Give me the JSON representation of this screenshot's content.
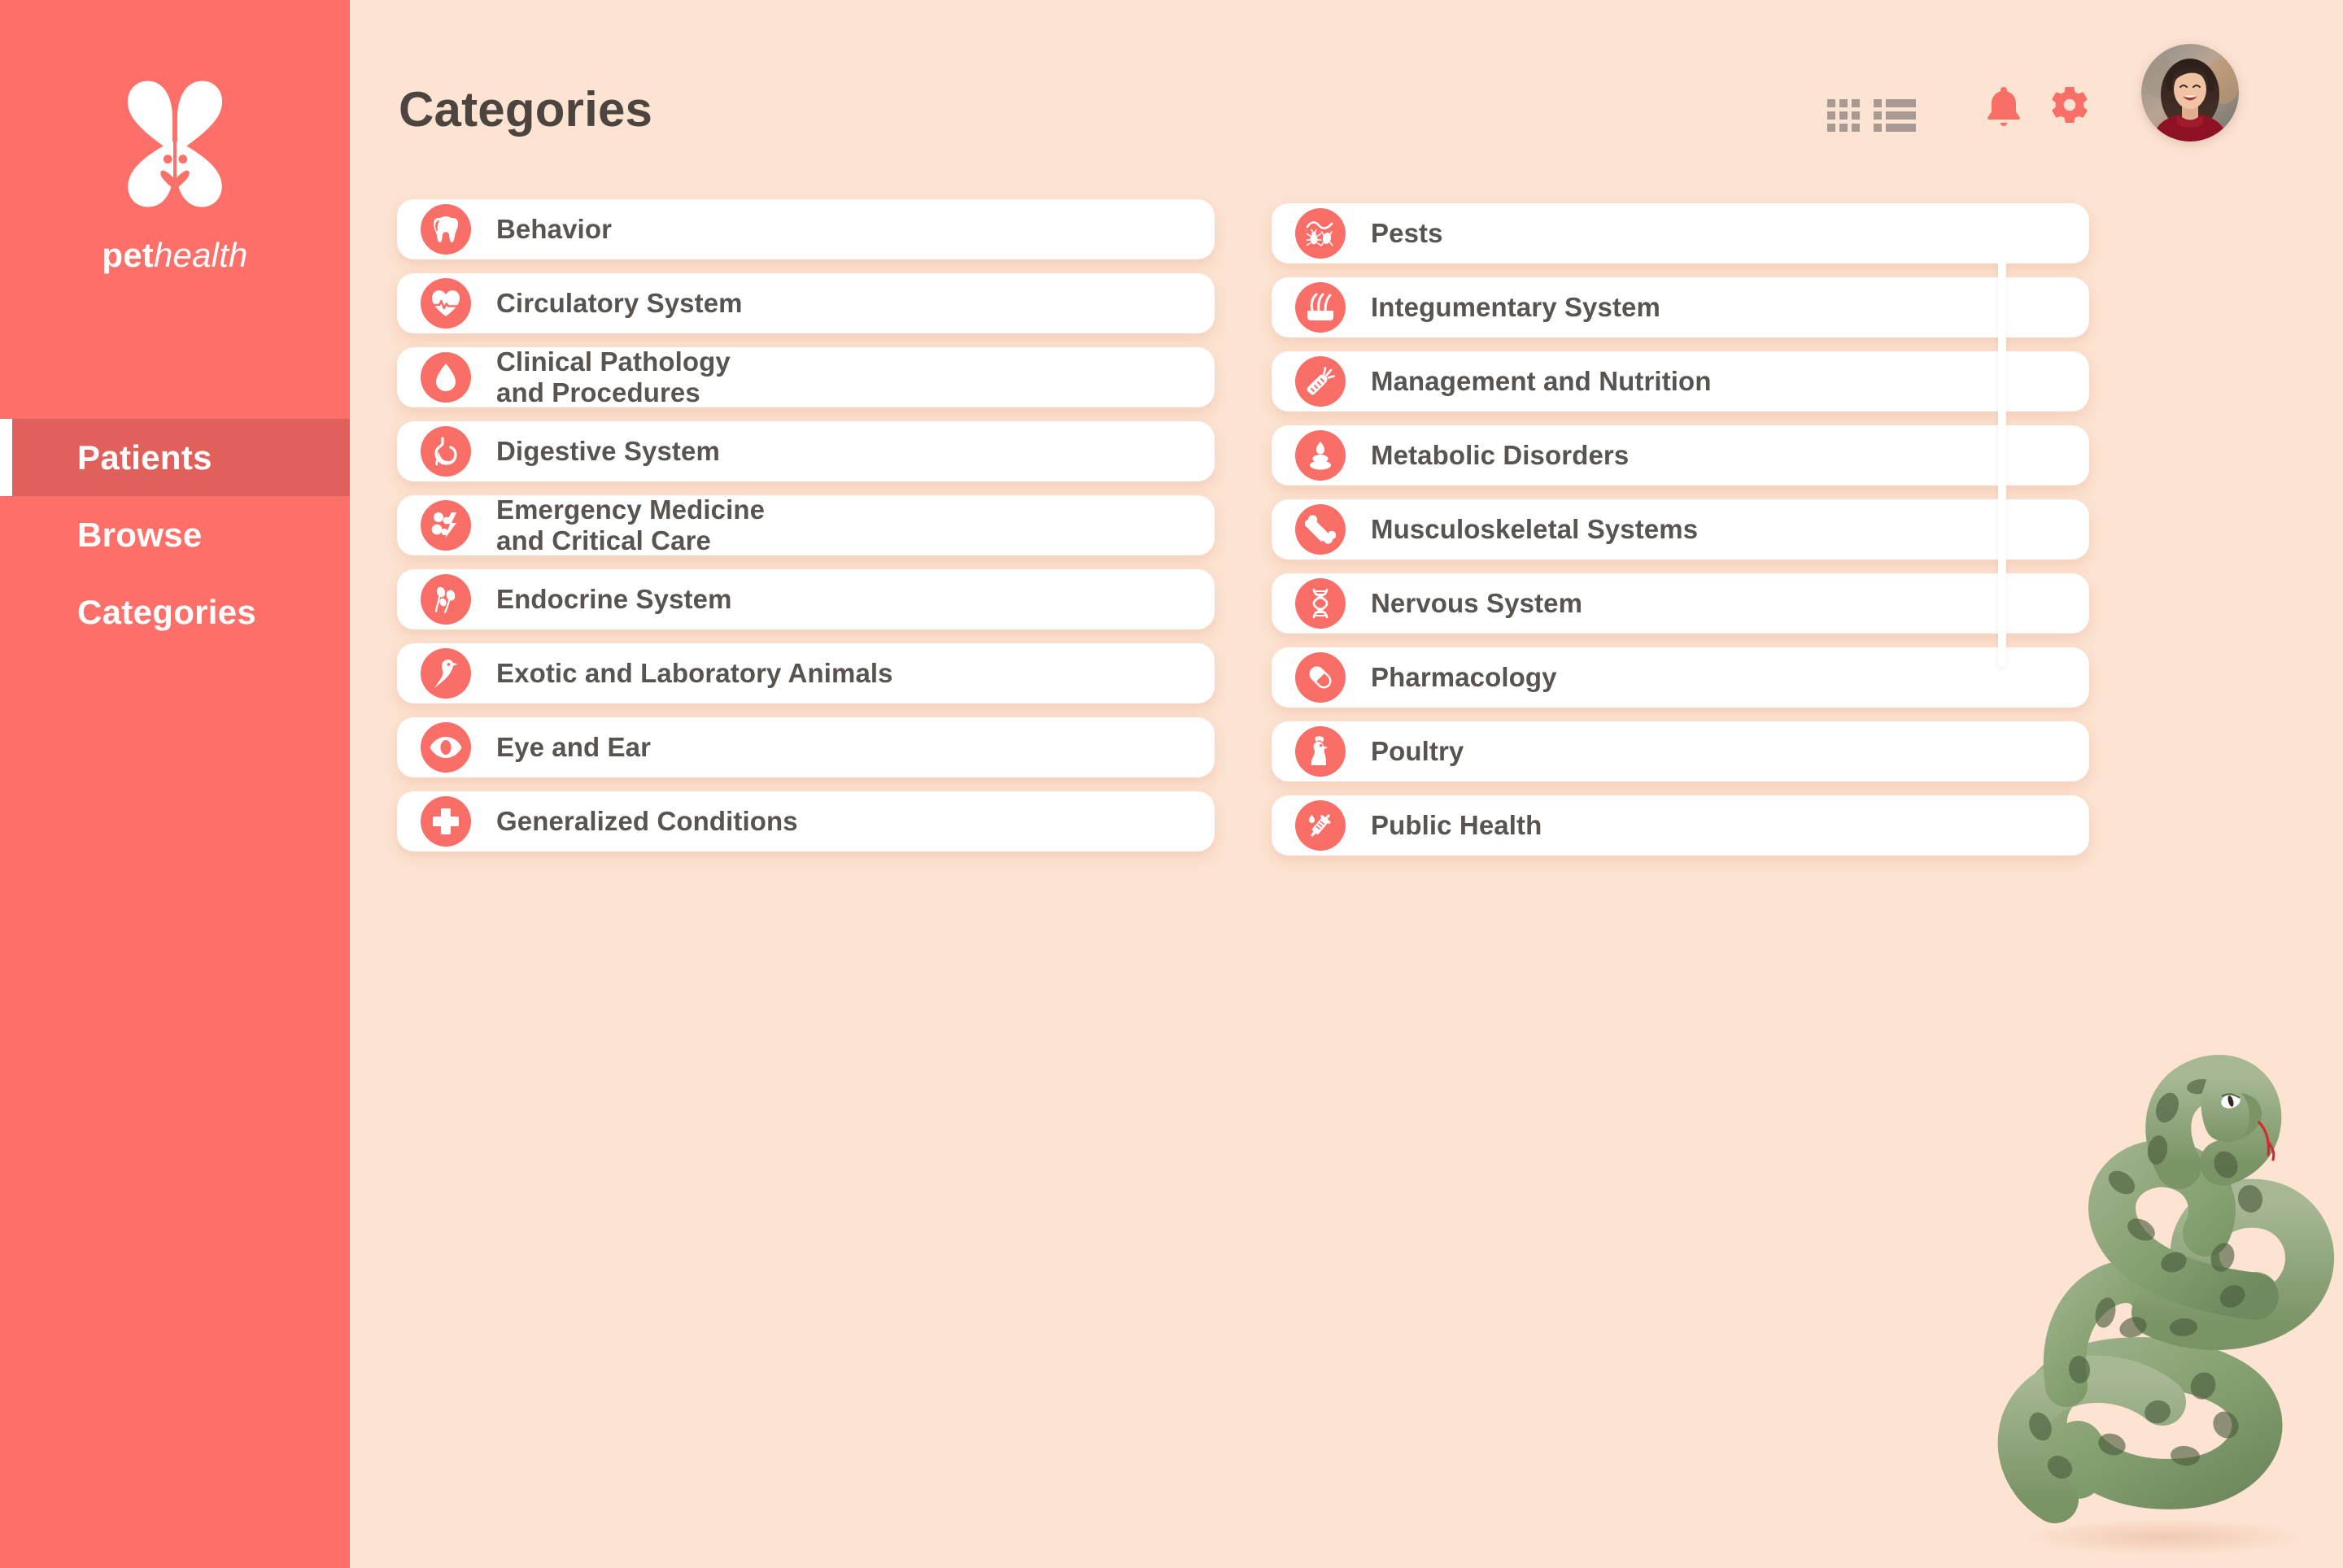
{
  "brand": {
    "name_bold": "pet",
    "name_italic": "health",
    "logo_icon": "butterfly-bunny-logo",
    "sidebar_color": "#FC7069",
    "background_color": "#FCE3D2",
    "accent_color": "#F96F68",
    "active_nav_color": "#E0615C"
  },
  "sidebar": {
    "items": [
      {
        "label": "Patients",
        "active": true
      },
      {
        "label": "Browse",
        "active": false
      },
      {
        "label": "Categories",
        "active": false
      }
    ]
  },
  "header": {
    "title": "Categories",
    "view_toggles": [
      {
        "name": "grid-view-icon",
        "active": false
      },
      {
        "name": "list-view-icon",
        "active": true
      }
    ],
    "actions": [
      {
        "name": "notifications-bell-icon",
        "label": "Notifications"
      },
      {
        "name": "settings-gear-icon",
        "label": "Settings"
      }
    ],
    "avatar": {
      "name": "user-avatar",
      "description": "Smiling woman with dark wavy hair in burgundy top"
    }
  },
  "main": {
    "columns": [
      {
        "items": [
          {
            "label": "Behavior",
            "icon": "tooth-icon"
          },
          {
            "label": "Circulatory System",
            "icon": "heart-pulse-icon"
          },
          {
            "label": "Clinical Pathology\nand Procedures",
            "icon": "blood-drop-icon"
          },
          {
            "label": "Digestive System",
            "icon": "stomach-icon"
          },
          {
            "label": "Emergency Medicine\nand Critical Care",
            "icon": "emergency-cells-icon"
          },
          {
            "label": "Endocrine System",
            "icon": "hormone-glands-icon"
          },
          {
            "label": "Exotic and Laboratory Animals",
            "icon": "bird-icon"
          },
          {
            "label": "Eye and Ear",
            "icon": "eye-icon"
          },
          {
            "label": "Generalized Conditions",
            "icon": "medical-cross-icon"
          }
        ]
      },
      {
        "items": [
          {
            "label": "Pests",
            "icon": "insect-pests-icon"
          },
          {
            "label": "Integumentary System",
            "icon": "skin-hair-icon"
          },
          {
            "label": "Management and Nutrition",
            "icon": "carrot-icon"
          },
          {
            "label": "Metabolic Disorders",
            "icon": "fat-blob-icon"
          },
          {
            "label": "Musculoskeletal Systems",
            "icon": "bone-icon"
          },
          {
            "label": "Nervous System",
            "icon": "dna-helix-icon"
          },
          {
            "label": "Pharmacology",
            "icon": "pill-capsule-icon"
          },
          {
            "label": "Poultry",
            "icon": "chicken-icon"
          },
          {
            "label": "Public Health",
            "icon": "syringe-icon"
          }
        ]
      }
    ]
  },
  "scrollbar": {
    "name": "vertical-scrollbar",
    "position": "right"
  },
  "decoration": {
    "name": "coiled-snake-illustration",
    "description": "Green coiled snake with dark blotches and red forked tongue"
  }
}
